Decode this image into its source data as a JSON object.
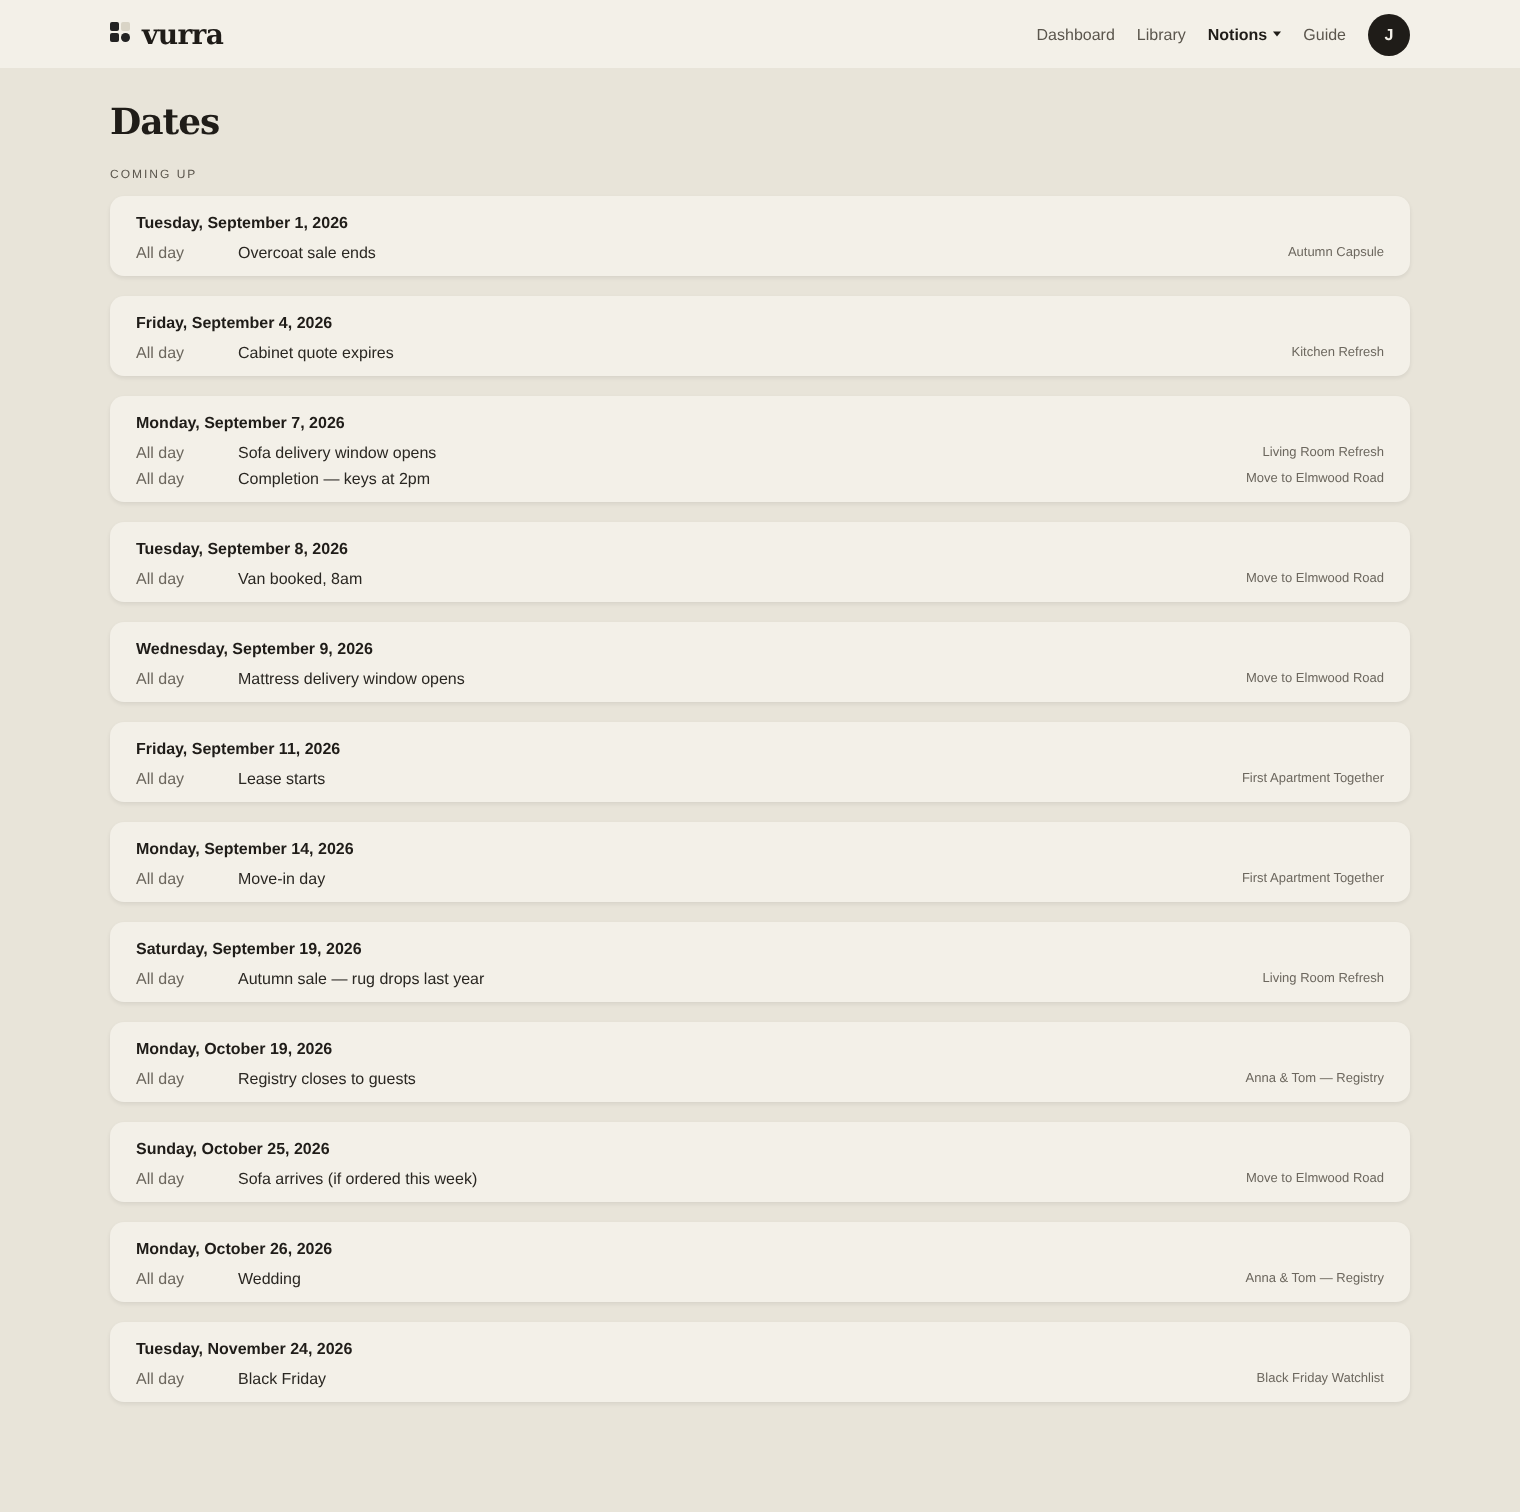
{
  "brand": {
    "name": "vurra"
  },
  "nav": [
    {
      "label": "Dashboard",
      "selected": false,
      "has_menu": false
    },
    {
      "label": "Library",
      "selected": false,
      "has_menu": false
    },
    {
      "label": "Notions",
      "selected": true,
      "has_menu": true
    },
    {
      "label": "Guide",
      "selected": false,
      "has_menu": false
    }
  ],
  "avatar": {
    "initial": "J"
  },
  "page_title": "Dates",
  "section_label": "COMING UP",
  "days": [
    {
      "date": "Tuesday, September 1, 2026",
      "events": [
        {
          "time": "All day",
          "title": "Overcoat sale ends",
          "source": "Autumn Capsule"
        }
      ]
    },
    {
      "date": "Friday, September 4, 2026",
      "events": [
        {
          "time": "All day",
          "title": "Cabinet quote expires",
          "source": "Kitchen Refresh"
        }
      ]
    },
    {
      "date": "Monday, September 7, 2026",
      "events": [
        {
          "time": "All day",
          "title": "Sofa delivery window opens",
          "source": "Living Room Refresh"
        },
        {
          "time": "All day",
          "title": "Completion — keys at 2pm",
          "source": "Move to Elmwood Road"
        }
      ]
    },
    {
      "date": "Tuesday, September 8, 2026",
      "events": [
        {
          "time": "All day",
          "title": "Van booked, 8am",
          "source": "Move to Elmwood Road"
        }
      ]
    },
    {
      "date": "Wednesday, September 9, 2026",
      "events": [
        {
          "time": "All day",
          "title": "Mattress delivery window opens",
          "source": "Move to Elmwood Road"
        }
      ]
    },
    {
      "date": "Friday, September 11, 2026",
      "events": [
        {
          "time": "All day",
          "title": "Lease starts",
          "source": "First Apartment Together"
        }
      ]
    },
    {
      "date": "Monday, September 14, 2026",
      "events": [
        {
          "time": "All day",
          "title": "Move-in day",
          "source": "First Apartment Together"
        }
      ]
    },
    {
      "date": "Saturday, September 19, 2026",
      "events": [
        {
          "time": "All day",
          "title": "Autumn sale — rug drops last year",
          "source": "Living Room Refresh"
        }
      ]
    },
    {
      "date": "Monday, October 19, 2026",
      "events": [
        {
          "time": "All day",
          "title": "Registry closes to guests",
          "source": "Anna & Tom — Registry"
        }
      ]
    },
    {
      "date": "Sunday, October 25, 2026",
      "events": [
        {
          "time": "All day",
          "title": "Sofa arrives (if ordered this week)",
          "source": "Move to Elmwood Road"
        }
      ]
    },
    {
      "date": "Monday, October 26, 2026",
      "events": [
        {
          "time": "All day",
          "title": "Wedding",
          "source": "Anna & Tom — Registry"
        }
      ]
    },
    {
      "date": "Tuesday, November 24, 2026",
      "events": [
        {
          "time": "All day",
          "title": "Black Friday",
          "source": "Black Friday Watchlist"
        }
      ]
    }
  ]
}
